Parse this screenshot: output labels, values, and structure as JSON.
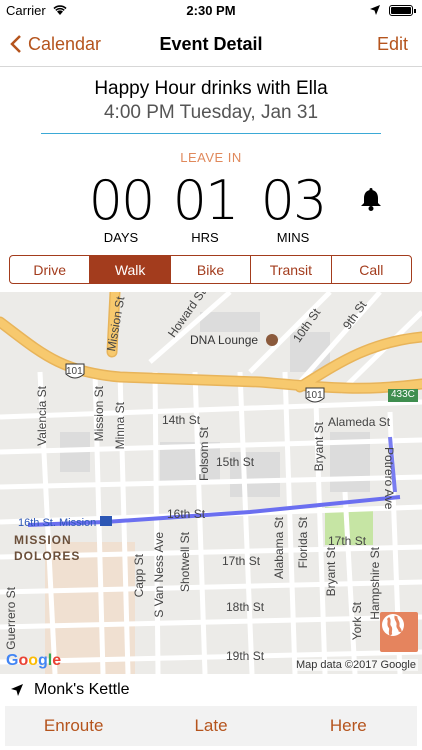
{
  "status_bar": {
    "carrier": "Carrier",
    "time": "2:30 PM"
  },
  "nav": {
    "back_label": "Calendar",
    "title": "Event Detail",
    "edit_label": "Edit"
  },
  "event": {
    "title": "Happy Hour drinks with Ella",
    "datetime": "4:00 PM Tuesday, Jan 31"
  },
  "countdown": {
    "heading": "LEAVE IN",
    "days": {
      "value": "00",
      "label": "DAYS"
    },
    "hours": {
      "value": "01",
      "label": "HRS"
    },
    "mins": {
      "value": "03",
      "label": "MINS"
    }
  },
  "modes": [
    "Drive",
    "Walk",
    "Bike",
    "Transit",
    "Call"
  ],
  "selected_mode": "Walk",
  "map": {
    "labels": {
      "mission_st_top": "Mission St",
      "howard_st": "Howard St",
      "tenth_st": "10th St",
      "ninth_st": "9th St",
      "dna_lounge": "DNA Lounge",
      "hwy101_a": "101",
      "hwy101_b": "101",
      "exit433c": "433C",
      "valencia_st": "Valencia St",
      "mission_st": "Mission St",
      "minna_st": "Minna St",
      "folsom_st": "Folsom St",
      "bryant_st": "Bryant St",
      "potrero_ave": "Potrero Ave",
      "alameda_st": "Alameda St",
      "fourteenth_st": "14th St",
      "fifteenth_st": "15th St",
      "sixteenth_st": "16th St",
      "sixteenth_st_b": "16th St",
      "seventeenth_st_a": "17th St",
      "seventeenth_st_b": "17th St",
      "eighteenth_st": "18th St",
      "nineteenth_st": "19th St",
      "bart_station": "16th St. Mission",
      "mission_dolores": "MISSION DOLORES",
      "s_van_ness": "S Van Ness Ave",
      "shotwell_st": "Shotwell St",
      "alabama_st": "Alabama St",
      "florida_st": "Florida St",
      "capp_st": "Capp St",
      "york_st": "York St",
      "hampshire_st": "Hampshire St",
      "guerrero_st": "Guerrero St",
      "bryant_st_2": "Bryant St"
    },
    "google": "Google",
    "credit": "Map data ©2017 Google",
    "colors": {
      "route": "#6b6ff0",
      "highway": "#f7c96e",
      "park": "#c6e5a4",
      "accent": "#b5541d"
    }
  },
  "destination": {
    "name": "Monk's Kettle"
  },
  "actions": {
    "enroute": "Enroute",
    "late": "Late",
    "here": "Here"
  }
}
